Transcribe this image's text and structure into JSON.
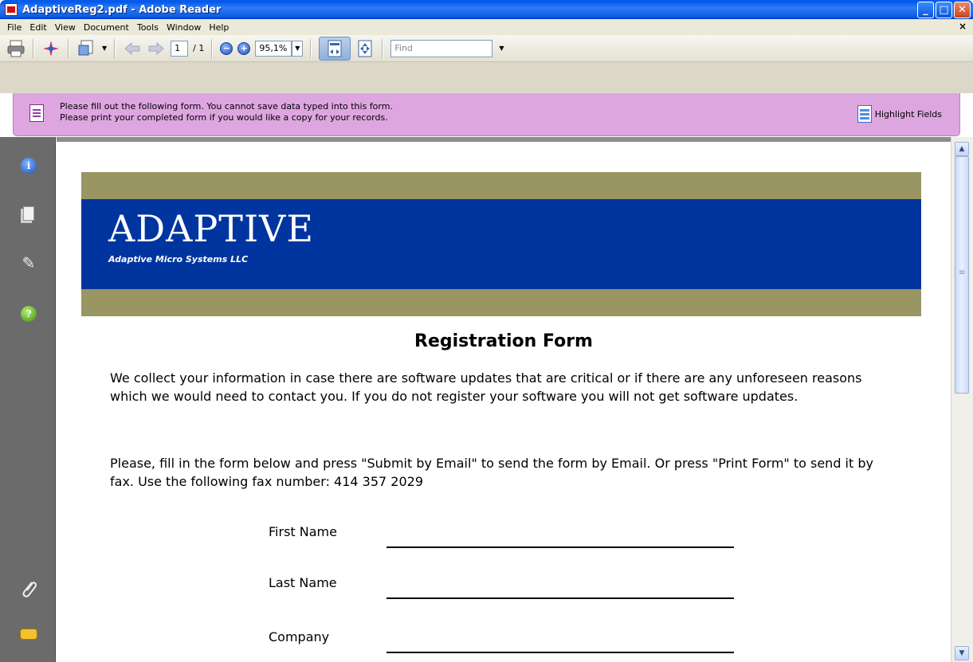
{
  "window": {
    "title": "AdaptiveReg2.pdf - Adobe Reader",
    "minimize": "_",
    "maximize": "□",
    "close": "✕"
  },
  "menu": {
    "items": [
      "File",
      "Edit",
      "View",
      "Document",
      "Tools",
      "Window",
      "Help"
    ],
    "close_glyph": "×"
  },
  "toolbar": {
    "page_current": "1",
    "page_total": "/ 1",
    "zoom_out": "−",
    "zoom_in": "+",
    "zoom_value": "95,1%",
    "find_placeholder": "Find",
    "icons": [
      "print-icon",
      "collaborate-icon",
      "page-display-icon",
      "previous-page-icon",
      "next-page-icon",
      "fit-width-icon",
      "fit-page-icon"
    ]
  },
  "notice": {
    "line1": "Please fill out the following form. You cannot save data typed into this form.",
    "line2": "Please print your completed form if you would like a copy for your records.",
    "highlight_label": "Highlight Fields"
  },
  "nav": {
    "info_glyph": "i",
    "help_glyph": "?",
    "sign_glyph": "✎",
    "clip_glyph": "⌇"
  },
  "document": {
    "logo": "ADAPTIVE",
    "logo_sub": "Adaptive Micro Systems LLC",
    "title": "Registration Form",
    "para1": "We collect your information in case there are software updates that are critical or if there are any unforeseen reasons which we would need to contact you. If you do not register your software you will not get software updates.",
    "para2": "Please, fill in the form below and press \"Submit by Email\" to send the form by Email. Or press \"Print Form\" to send it by fax. Use the following fax number: 414 357 2029",
    "fields": [
      {
        "label": "First Name"
      },
      {
        "label": "Last Name"
      },
      {
        "label": "Company"
      }
    ]
  },
  "scrollbar": {
    "up_glyph": "▲",
    "down_glyph": "▼"
  },
  "colors": {
    "notice_bg": "#dea6e0",
    "banner_blue": "#0035a0",
    "banner_olive": "#999663",
    "titlebar_blue": "#0058ee"
  }
}
